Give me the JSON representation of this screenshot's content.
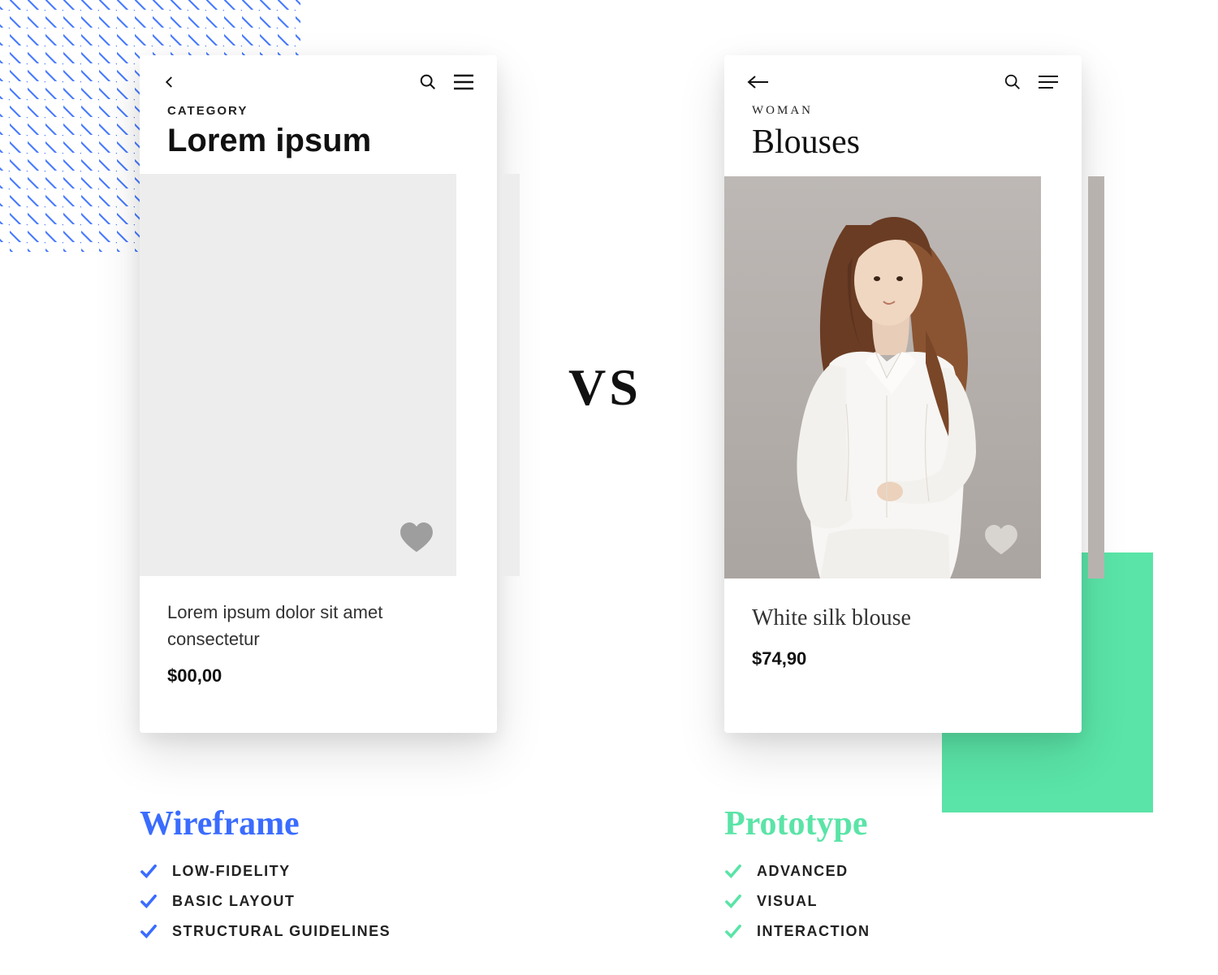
{
  "divider": "VS",
  "wireframe": {
    "eyebrow": "CATEGORY",
    "title": "Lorem ipsum",
    "product_name": "Lorem ipsum dolor sit amet consectetur",
    "price": "$00,00",
    "section_title": "Wireframe",
    "bullets": [
      "LOW-FIDELITY",
      "BASIC LAYOUT",
      "STRUCTURAL GUIDELINES"
    ]
  },
  "prototype": {
    "eyebrow": "WOMAN",
    "title": "Blouses",
    "product_name": "White silk blouse",
    "price": "$74,90",
    "section_title": "Prototype",
    "bullets": [
      "ADVANCED",
      "VISUAL",
      "INTERACTION"
    ]
  },
  "colors": {
    "blue": "#3a6cff",
    "green": "#5ae4a7"
  }
}
